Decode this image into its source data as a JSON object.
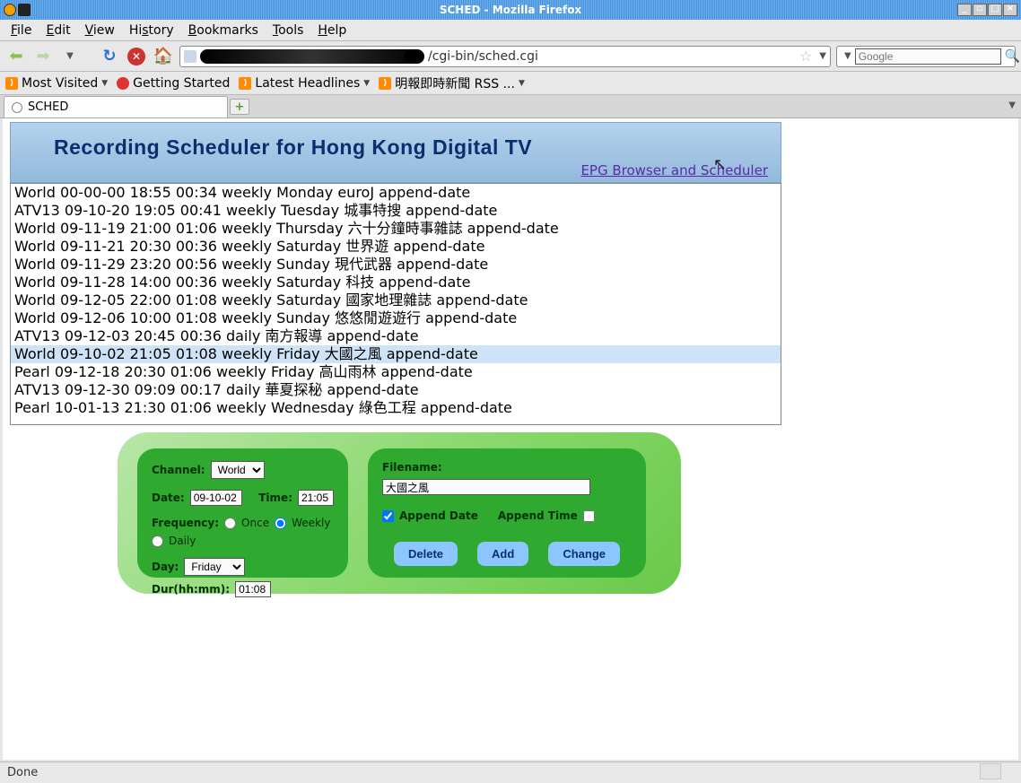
{
  "window": {
    "title": "SCHED - Mozilla Firefox"
  },
  "menubar": {
    "items": [
      "File",
      "Edit",
      "View",
      "History",
      "Bookmarks",
      "Tools",
      "Help"
    ]
  },
  "url": {
    "suffix": "/cgi-bin/sched.cgi"
  },
  "search": {
    "placeholder": "Google"
  },
  "bookmarks": {
    "items": [
      {
        "label": "Most Visited",
        "icon": "rss",
        "drop": true
      },
      {
        "label": "Getting Started",
        "icon": "red",
        "drop": false
      },
      {
        "label": "Latest Headlines",
        "icon": "rss",
        "drop": true
      },
      {
        "label": "明報即時新聞 RSS ...",
        "icon": "rss",
        "drop": true
      }
    ]
  },
  "tab": {
    "label": "SCHED"
  },
  "banner": {
    "title": "Recording Scheduler for Hong Kong Digital TV",
    "link": "EPG Browser and Scheduler"
  },
  "schedule": {
    "items": [
      {
        "text": "World 00-00-00 18:55 00:34 weekly Monday euroJ append-date",
        "selected": false
      },
      {
        "text": "ATV13 09-10-20 19:05 00:41 weekly Tuesday 城事特搜 append-date",
        "selected": false
      },
      {
        "text": "World 09-11-19 21:00 01:06 weekly Thursday 六十分鐘時事雜誌 append-date",
        "selected": false
      },
      {
        "text": "World 09-11-21 20:30 00:36 weekly Saturday 世界遊 append-date",
        "selected": false
      },
      {
        "text": "World 09-11-29 23:20 00:56 weekly Sunday 現代武器 append-date",
        "selected": false
      },
      {
        "text": "World 09-11-28 14:00 00:36 weekly Saturday 科技 append-date",
        "selected": false
      },
      {
        "text": "World 09-12-05 22:00 01:08 weekly Saturday 國家地理雜誌 append-date",
        "selected": false
      },
      {
        "text": "World 09-12-06 10:00 01:08 weekly Sunday 悠悠閒遊遊行 append-date",
        "selected": false
      },
      {
        "text": "ATV13 09-12-03 20:45 00:36 daily 南方報導 append-date",
        "selected": false
      },
      {
        "text": "World 09-10-02 21:05 01:08 weekly Friday 大國之風 append-date",
        "selected": true
      },
      {
        "text": "Pearl 09-12-18 20:30 01:06 weekly Friday 高山雨林 append-date",
        "selected": false
      },
      {
        "text": "ATV13 09-12-30 09:09 00:17 daily 華夏探秘 append-date",
        "selected": false
      },
      {
        "text": "Pearl 10-01-13 21:30 01:06 weekly Wednesday 綠色工程 append-date",
        "selected": false
      }
    ]
  },
  "form": {
    "labels": {
      "channel": "Channel:",
      "date": "Date:",
      "time": "Time:",
      "frequency": "Frequency:",
      "once": "Once",
      "weekly": "Weekly",
      "daily": "Daily",
      "day": "Day:",
      "dur": "Dur(hh:mm):",
      "filename": "Filename:",
      "append_date": "Append Date",
      "append_time": "Append Time"
    },
    "values": {
      "channel": "World",
      "date": "09-10-02",
      "time": "21:05",
      "day": "Friday",
      "dur": "01:08",
      "filename": "大國之風",
      "freq_selected": "weekly",
      "append_date": true,
      "append_time": false
    },
    "buttons": {
      "delete": "Delete",
      "add": "Add",
      "change": "Change"
    }
  },
  "status": {
    "text": "Done"
  }
}
